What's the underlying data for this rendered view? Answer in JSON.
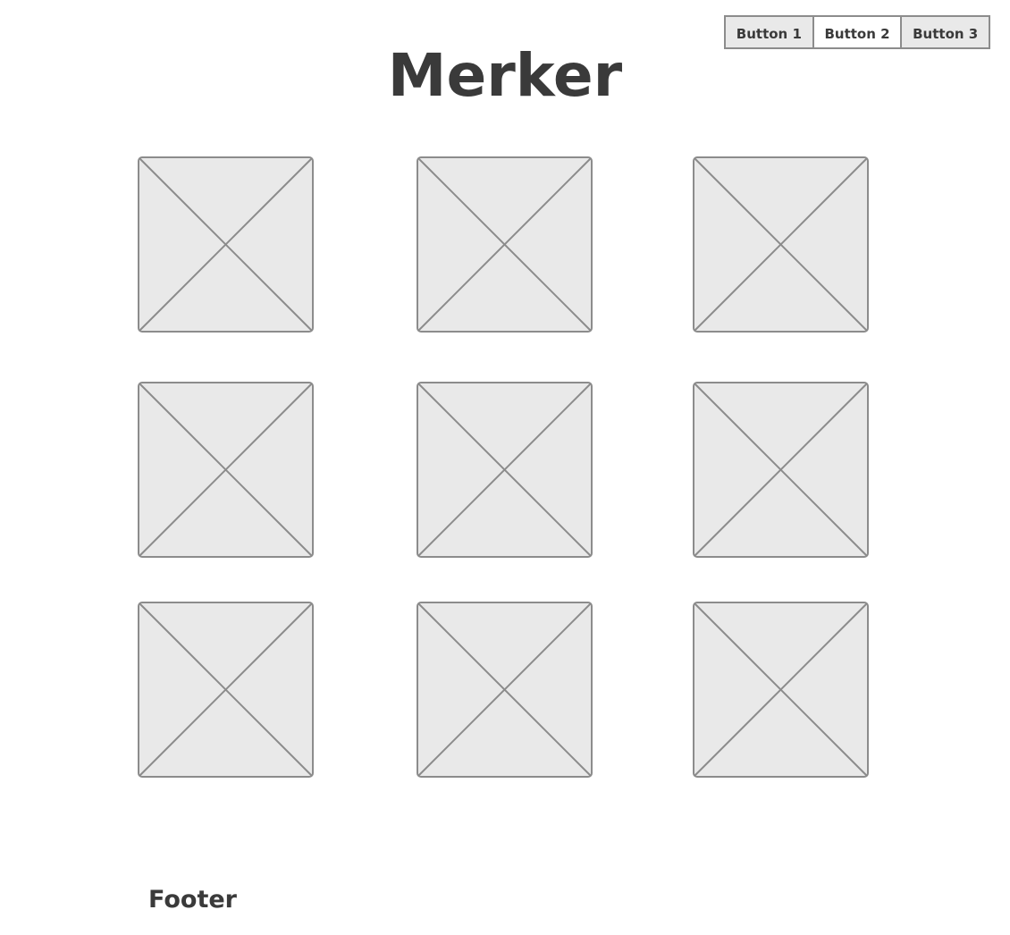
{
  "header": {
    "title": "Merker",
    "buttons": [
      {
        "label": "Button 1",
        "selected": false
      },
      {
        "label": "Button 2",
        "selected": true
      },
      {
        "label": "Button 3",
        "selected": false
      }
    ]
  },
  "grid": {
    "rows": 3,
    "columns": 3,
    "items": [
      {
        "icon": "image-placeholder-icon"
      },
      {
        "icon": "image-placeholder-icon"
      },
      {
        "icon": "image-placeholder-icon"
      },
      {
        "icon": "image-placeholder-icon"
      },
      {
        "icon": "image-placeholder-icon"
      },
      {
        "icon": "image-placeholder-icon"
      },
      {
        "icon": "image-placeholder-icon"
      },
      {
        "icon": "image-placeholder-icon"
      },
      {
        "icon": "image-placeholder-icon"
      }
    ]
  },
  "footer": {
    "label": "Footer"
  },
  "colors": {
    "placeholder_fill": "#e9e9e9",
    "placeholder_stroke": "#8c8c8c",
    "text": "#3a3a3a"
  }
}
